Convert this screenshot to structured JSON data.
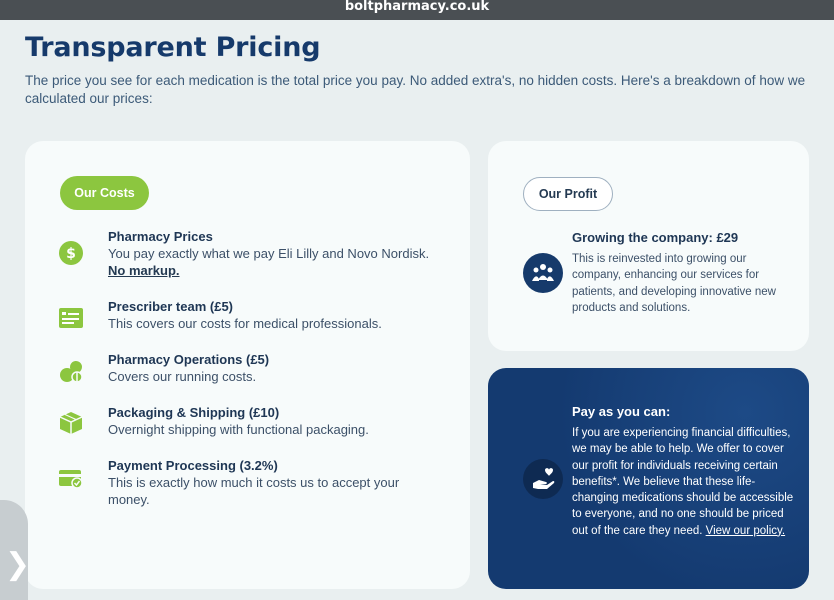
{
  "browser": {
    "url": "boltpharmacy.co.uk"
  },
  "page": {
    "title": "Transparent Pricing",
    "intro": "The price you see for each medication is the total price you pay. No added extra's, no hidden costs. Here's a breakdown of how we calculated our prices:"
  },
  "costs": {
    "pill_label": "Our Costs",
    "items": [
      {
        "icon": "dollar-icon",
        "title": "Pharmacy Prices",
        "desc": "You pay exactly what we pay Eli Lilly and Novo Nordisk. ",
        "link": "No markup."
      },
      {
        "icon": "prescription-icon",
        "title": "Prescriber team (£5)",
        "desc": "This covers our costs for medical professionals."
      },
      {
        "icon": "pills-icon",
        "title": "Pharmacy Operations (£5)",
        "desc": "Covers our running costs."
      },
      {
        "icon": "package-icon",
        "title": "Packaging & Shipping (£10)",
        "desc": "Overnight shipping with functional packaging."
      },
      {
        "icon": "card-icon",
        "title": "Payment Processing (3.2%)",
        "desc": "This is exactly how much it costs us to accept your money."
      }
    ]
  },
  "profit": {
    "pill_label": "Our Profit",
    "icon": "team-icon",
    "title": "Growing the company: £29",
    "desc": "This is reinvested into growing our company, enhancing our services for patients, and developing innovative new products and solutions."
  },
  "pay": {
    "icon": "hand-heart-icon",
    "title": "Pay as you can:",
    "desc": "If you are experiencing financial difficulties, we may be able to help. We offer to cover our profit for individuals receiving certain benefits*. We believe that these life-changing medications should be accessible to everyone, and no one should be priced out of the care they need. ",
    "link": "View our policy."
  },
  "side_tab": {
    "glyph": "❯"
  },
  "colors": {
    "accent_green": "#8cc63f",
    "navy": "#143a70",
    "title_blue": "#163a6b"
  }
}
